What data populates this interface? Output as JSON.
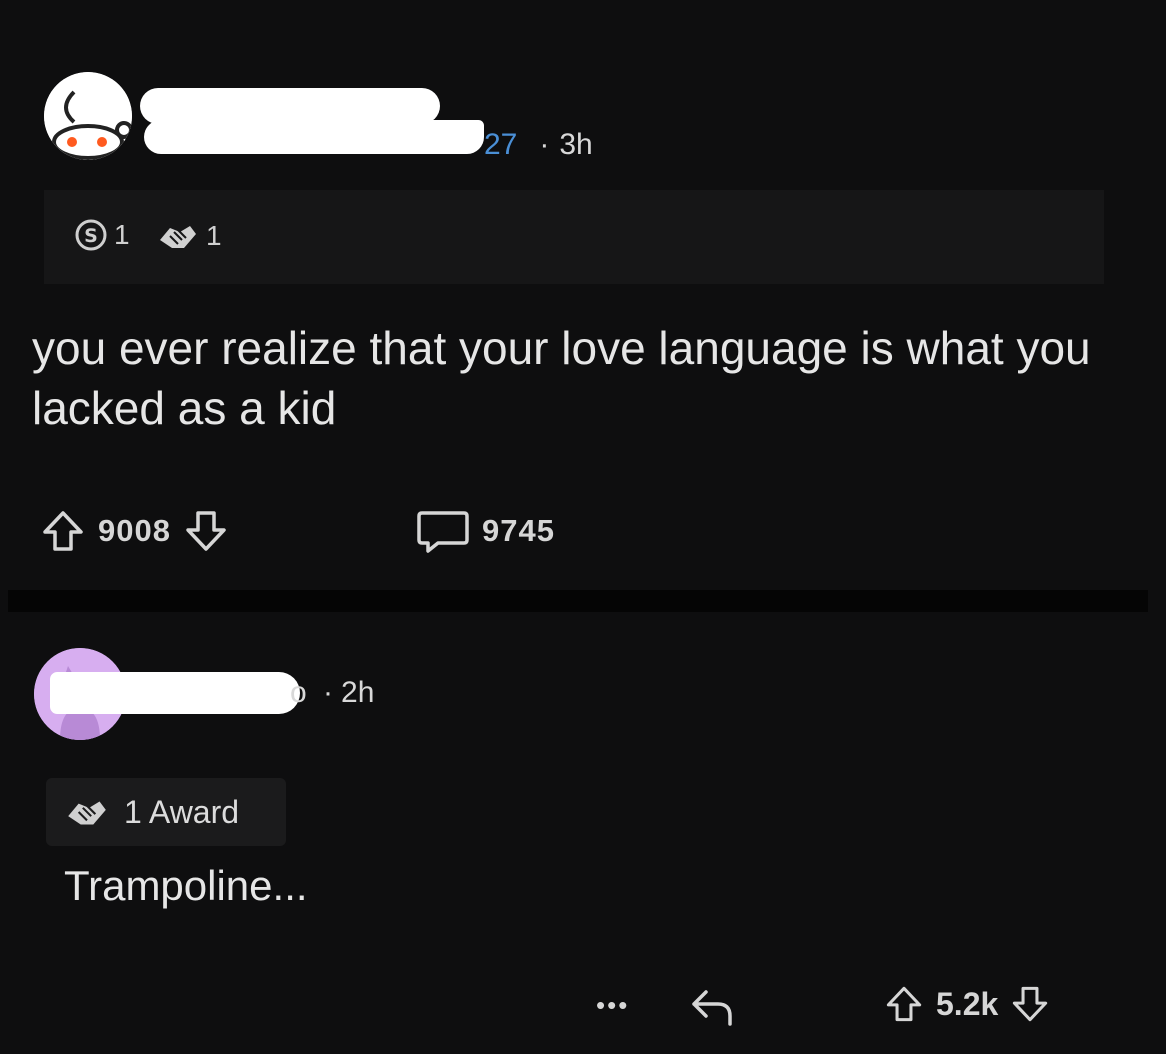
{
  "post": {
    "username_visible_tail": "27",
    "separator": "·",
    "age": "3h",
    "awards": [
      {
        "icon": "silver-award-icon",
        "count": "1"
      },
      {
        "icon": "handshake-award-icon",
        "count": "1"
      }
    ],
    "title": "you ever realize that your love language is what you lacked as a kid",
    "upvote_count": "9008",
    "comment_count": "9745"
  },
  "comment": {
    "username_visible_tail": "o",
    "separator": "·",
    "age": "2h",
    "award_label": "1 Award",
    "body": "Trampoline...",
    "more_label": "•••",
    "score": "5.2k"
  },
  "colors": {
    "background": "#0e0e0f",
    "username_link": "#4a8fd6",
    "comment_avatar": "#d7aef0"
  }
}
